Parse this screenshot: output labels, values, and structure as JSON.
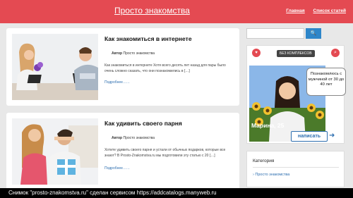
{
  "header": {
    "site_title": "Просто знакомства",
    "nav": [
      "Главная",
      "Список статей"
    ]
  },
  "posts": [
    {
      "title": "Как знакомиться в интернете",
      "author_label": "Автор",
      "author": "Просто знакомства",
      "excerpt": "Как знакомиться в интернете Хотя всего десять лет назад для пары было очень сложно сказать, что они познакомились в […]",
      "more": "Подробнее……"
    },
    {
      "title": "Как удивить своего парня",
      "author_label": "Автор",
      "author": "Просто знакомства",
      "excerpt": "Хотите удивить своего парня и устали от обычных подарков, которые все знают? В Prosto-Znakomstva.ru мы подготовили эту статью с 20 […]",
      "more": "Подробнее……"
    }
  ],
  "sidebar": {
    "search_placeholder": "",
    "search_button": "🔍",
    "ad": {
      "logo": "БЕЗ КОМПЛЕКСОВ",
      "bubble": "Познакомлюсь с мужчиной от 30 до 40 лет",
      "name": "Марина, 25",
      "button": "написать",
      "arrow": "➜"
    },
    "category_title": "Категория",
    "category_item": "Просто знакомства"
  },
  "caption": "Снимок \"prosto-znakomstva.ru\" сделан сервисом https://addcatalogs.manyweb.ru"
}
